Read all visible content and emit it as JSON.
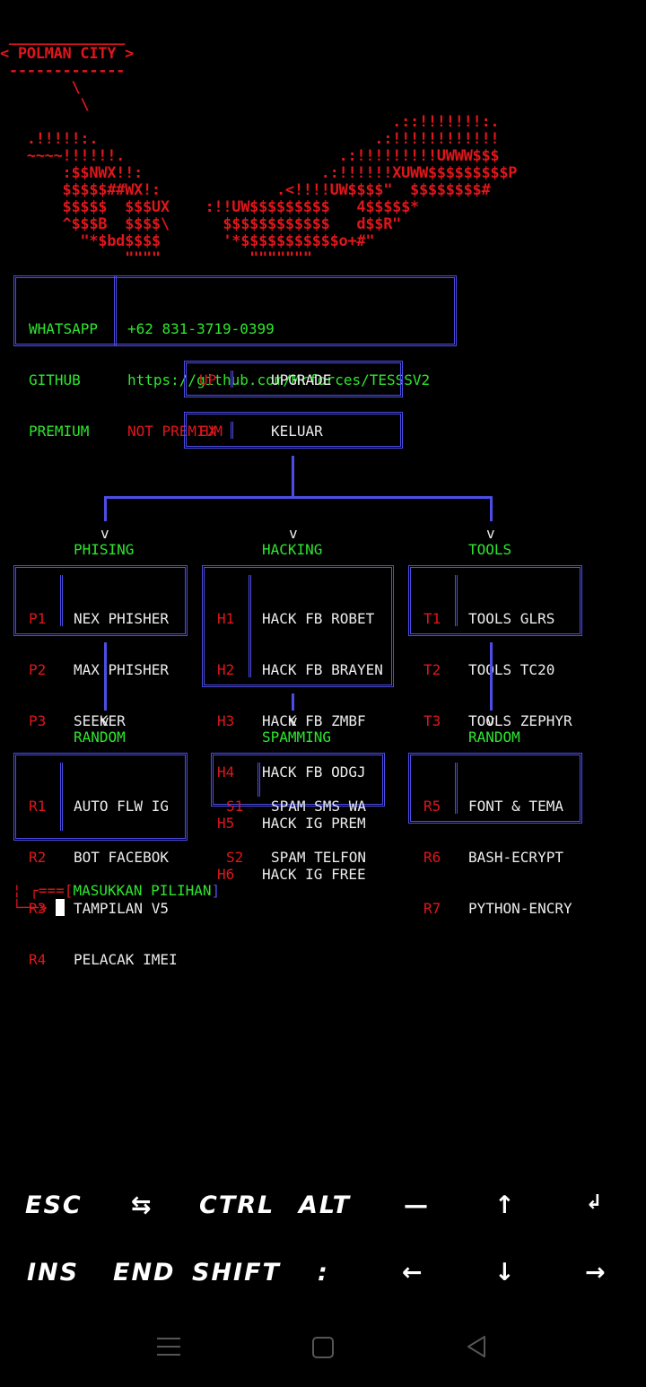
{
  "banner": {
    "title": "POLMAN CITY",
    "art": " _____________\n< POLMAN CITY >\n -------------\n        \\\n         \\\n                                            .::!!!!!!!:.\n   .!!!!!:.                               .:!!!!!!!!!!!!\n   ~~~~!!!!!!.                        .:!!!!!!!!!UWWW$$$\n       :$$NWX!!:                    .:!!!!!!XUWW$$$$$$$$$P\n       $$$$$##WX!:             .<!!!!UW$$$$\"  $$$$$$$$#\n       $$$$$  $$$UX    :!!UW$$$$$$$$$   4$$$$$*\n       ^$$$B  $$$$\\      $$$$$$$$$$$$   d$$R\"\n         \"*$bd$$$$       '*$$$$$$$$$$$o+#\"\n              \"\"\"\"          \"\"\"\"\"\"\""
  },
  "info": {
    "labels": [
      "WHATSAPP",
      "GITHUB",
      "PREMIUM"
    ],
    "whatsapp": "+62 831-3719-0399",
    "github": "https://github.com/Mrforces/TESSSV2",
    "premium": "NOT PREMIUM"
  },
  "actions": [
    {
      "code": "UP",
      "label": "UPGRADE"
    },
    {
      "code": "EX",
      "label": "KELUAR"
    }
  ],
  "arrow": "v",
  "categories": [
    {
      "title": "PHISING",
      "items": [
        {
          "code": "P1",
          "label": "NEX PHISHER"
        },
        {
          "code": "P2",
          "label": "MAX PHISHER"
        },
        {
          "code": "P3",
          "label": "SEEKER"
        }
      ]
    },
    {
      "title": "HACKING",
      "items": [
        {
          "code": "H1",
          "label": "HACK FB ROBET"
        },
        {
          "code": "H2",
          "label": "HACK FB BRAYEN"
        },
        {
          "code": "H3",
          "label": "HACK FB ZMBF"
        },
        {
          "code": "H4",
          "label": "HACK FB ODGJ"
        },
        {
          "code": "H5",
          "label": "HACK IG PREM"
        },
        {
          "code": "H6",
          "label": "HACK IG FREE"
        }
      ]
    },
    {
      "title": "TOOLS",
      "items": [
        {
          "code": "T1",
          "label": "TOOLS GLRS"
        },
        {
          "code": "T2",
          "label": "TOOLS TC20"
        },
        {
          "code": "T3",
          "label": "TOOLS ZEPHYR"
        }
      ]
    },
    {
      "title": "RANDOM",
      "items": [
        {
          "code": "R1",
          "label": "AUTO FLW IG"
        },
        {
          "code": "R2",
          "label": "BOT FACEBOK"
        },
        {
          "code": "R3",
          "label": "TAMPILAN V5"
        },
        {
          "code": "R4",
          "label": "PELACAK IMEI"
        }
      ]
    },
    {
      "title": "SPAMMING",
      "items": [
        {
          "code": "S1",
          "label": "SPAM SMS WA"
        },
        {
          "code": "S2",
          "label": "SPAM TELFON"
        }
      ]
    },
    {
      "title": "RANDOM",
      "items": [
        {
          "code": "R5",
          "label": "FONT & TEMA"
        },
        {
          "code": "R6",
          "label": "BASH-ECRYPT"
        },
        {
          "code": "R7",
          "label": "PYTHON-ENCRY"
        }
      ]
    }
  ],
  "prompt": {
    "top": "┌===[",
    "label": "MASUKKAN PILIHAN",
    "close": "]",
    "mid": "¦",
    "arrow": "└──>"
  },
  "extra_keys": {
    "row1": [
      "ESC",
      "⇆",
      "CTRL",
      "ALT",
      "—",
      "↑",
      "↲"
    ],
    "row2": [
      "INS",
      "END",
      "SHIFT",
      ":",
      "←",
      "↓",
      "→"
    ]
  },
  "nav_icons": [
    "menu-icon",
    "home-icon",
    "back-icon"
  ]
}
